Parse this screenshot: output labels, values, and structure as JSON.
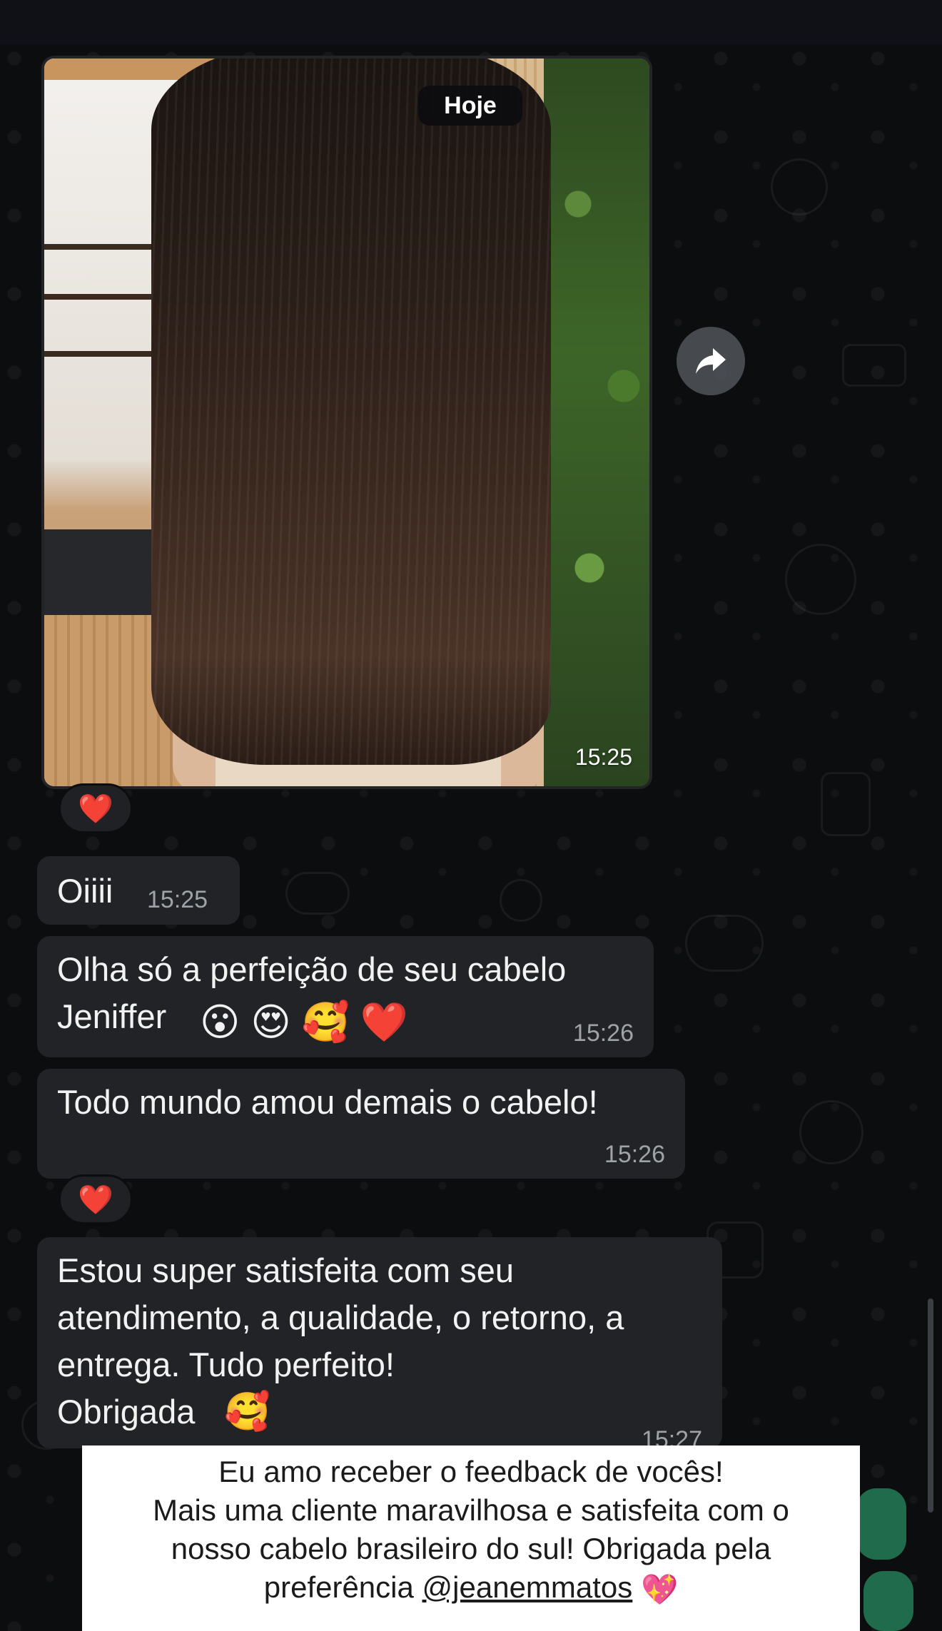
{
  "chat": {
    "date_label": "Hoje",
    "image_message": {
      "time": "15:25"
    },
    "messages": [
      {
        "text": "Oiiii",
        "time": "15:25"
      },
      {
        "text": "Olha só a perfeição de seu cabelo\nJeniffer",
        "time": "15:26",
        "emojis": [
          "😮",
          "😍",
          "🥰",
          "❤️"
        ]
      },
      {
        "text": "Todo mundo amou demais o cabelo!",
        "time": "15:26"
      },
      {
        "text": "Estou super satisfeita com seu\natendimento, a qualidade, o retorno, a\nentrega. Tudo perfeito!\nObrigada",
        "time": "15:27",
        "emojis": [
          "🥰"
        ]
      }
    ],
    "reactions": [
      "❤️",
      "❤️"
    ]
  },
  "caption": {
    "line1": "Eu amo receber o feedback de vocês!",
    "line2": "Mais uma cliente maravilhosa e satisfeita com o",
    "line3": "nosso cabelo brasileiro do sul! Obrigada pela",
    "line4_prefix": "preferência",
    "mention": "@jeanemmatos",
    "emoji": "💖"
  },
  "colors": {
    "background": "#0c0d0f",
    "bubble": "#212326",
    "caption_bg": "#ffffff"
  },
  "icons": [
    "forward-icon",
    "heart-icon"
  ]
}
